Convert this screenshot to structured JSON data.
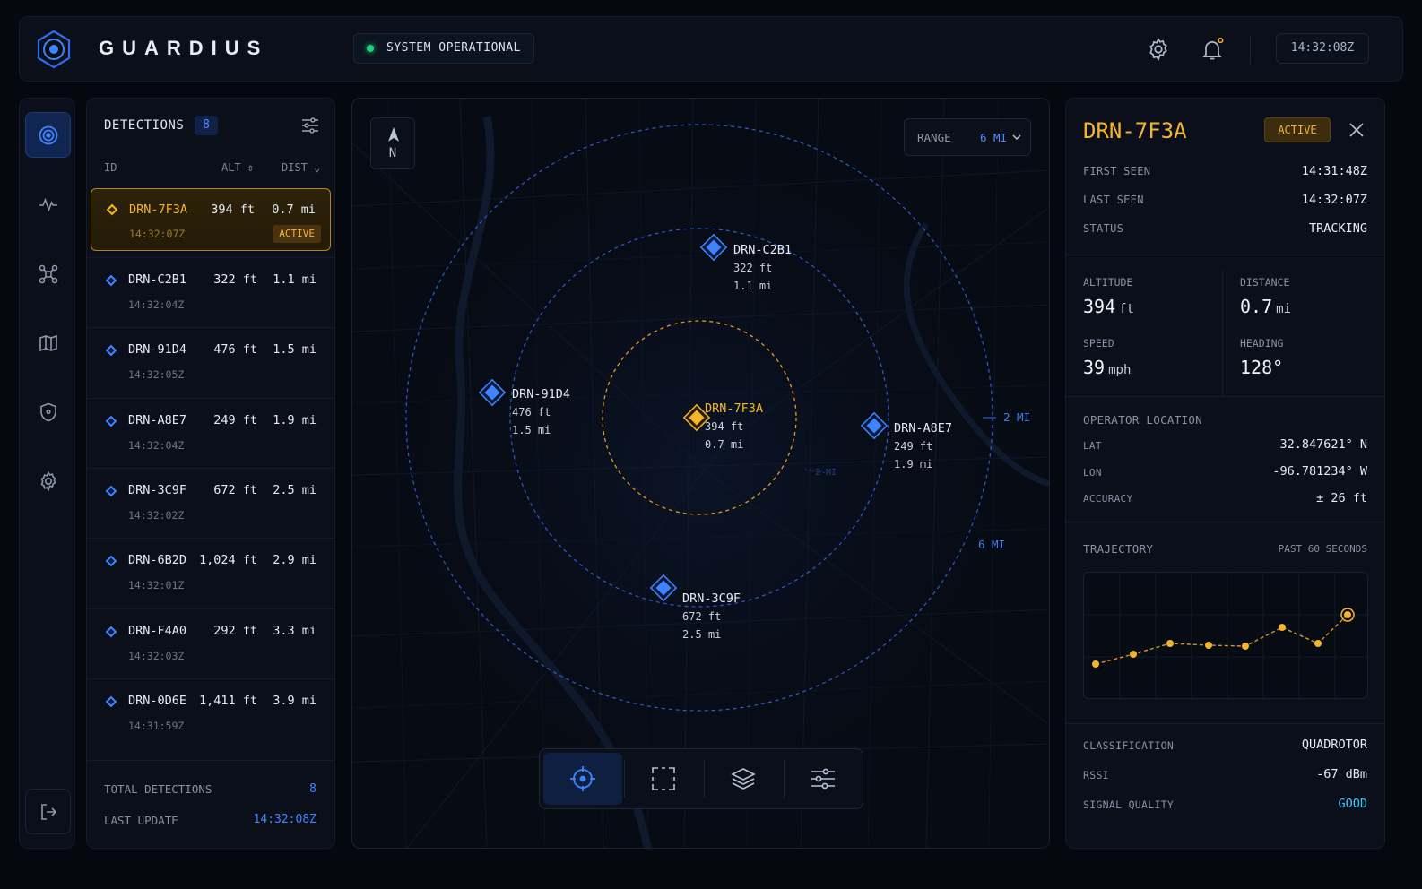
{
  "header": {
    "brand": "GUARDIUS",
    "status": "SYSTEM OPERATIONAL",
    "clock": "14:32:08Z",
    "icons": [
      "settings-gear-icon",
      "notification-bell-icon"
    ]
  },
  "rail": {
    "items": [
      "radar-icon",
      "activity-pulse-icon",
      "drone-icon",
      "map-icon",
      "shield-icon",
      "settings-icon"
    ],
    "active": "radar-icon",
    "logout": "logout-icon"
  },
  "detections": {
    "title": "DETECTIONS",
    "count": "8",
    "columns": {
      "id": "ID",
      "alt": "ALT",
      "dist": "DIST"
    },
    "rows": [
      {
        "id": "DRN-7F3A",
        "alt": "394 ft",
        "dist": "0.7 mi",
        "time": "14:32:07Z",
        "badge": "ACTIVE"
      },
      {
        "id": "DRN-C2B1",
        "alt": "322 ft",
        "dist": "1.1 mi",
        "time": "14:32:04Z"
      },
      {
        "id": "DRN-91D4",
        "alt": "476 ft",
        "dist": "1.5 mi",
        "time": "14:32:05Z"
      },
      {
        "id": "DRN-A8E7",
        "alt": "249 ft",
        "dist": "1.9 mi",
        "time": "14:32:04Z"
      },
      {
        "id": "DRN-3C9F",
        "alt": "672 ft",
        "dist": "2.5 mi",
        "time": "14:32:02Z"
      },
      {
        "id": "DRN-6B2D",
        "alt": "1,024 ft",
        "dist": "2.9 mi",
        "time": "14:32:01Z"
      },
      {
        "id": "DRN-F4A0",
        "alt": "292 ft",
        "dist": "3.3 mi",
        "time": "14:32:03Z"
      },
      {
        "id": "DRN-0D6E",
        "alt": "1,411 ft",
        "dist": "3.9 mi",
        "time": "14:31:59Z"
      }
    ],
    "footer": {
      "total_label": "TOTAL DETECTIONS",
      "total_value": "8",
      "update_label": "LAST UPDATE",
      "update_value": "14:32:08Z"
    }
  },
  "map": {
    "compass": "N",
    "range_label": "RANGE",
    "range_value": "6 MI",
    "rings": [
      "2 MI",
      "2 MI",
      "6 MI"
    ],
    "blips": [
      {
        "id": "DRN-7F3A",
        "alt": "394 ft",
        "dist": "0.7 mi",
        "selected": true
      },
      {
        "id": "DRN-C2B1",
        "alt": "322 ft",
        "dist": "1.1 mi"
      },
      {
        "id": "DRN-91D4",
        "alt": "476 ft",
        "dist": "1.5 mi"
      },
      {
        "id": "DRN-A8E7",
        "alt": "249 ft",
        "dist": "1.9 mi"
      },
      {
        "id": "DRN-3C9F",
        "alt": "672 ft",
        "dist": "2.5 mi"
      }
    ],
    "tools": [
      "target-crosshair-icon",
      "select-area-icon",
      "layers-icon",
      "sliders-icon"
    ],
    "active_tool": "target-crosshair-icon"
  },
  "detail": {
    "title": "DRN-7F3A",
    "badge": "ACTIVE",
    "first_seen_label": "FIRST SEEN",
    "first_seen": "14:31:48Z",
    "last_seen_label": "LAST SEEN",
    "last_seen": "14:32:07Z",
    "status_label": "STATUS",
    "status": "TRACKING",
    "altitude_label": "ALTITUDE",
    "altitude": "394",
    "altitude_unit": "ft",
    "distance_label": "DISTANCE",
    "distance": "0.7",
    "distance_unit": "mi",
    "speed_label": "SPEED",
    "speed": "39",
    "speed_unit": "mph",
    "heading_label": "HEADING",
    "heading": "128°",
    "operator_label": "OPERATOR LOCATION",
    "lat_label": "LAT",
    "lat": "32.847621° N",
    "lon_label": "LON",
    "lon": "-96.781234° W",
    "accuracy_label": "ACCURACY",
    "accuracy": "± 26 ft",
    "trajectory_label": "TRAJECTORY",
    "trajectory_window": "PAST 60 SECONDS",
    "classification_label": "CLASSIFICATION",
    "classification": "QUADROTOR",
    "rssi_label": "RSSI",
    "rssi": "-67 dBm",
    "signal_label": "SIGNAL QUALITY",
    "signal": "GOOD"
  },
  "colors": {
    "accent_blue": "#3f84ff",
    "accent_gold": "#f5b52a",
    "status_green": "#22d07a",
    "signal_good": "#38c6ff",
    "background": "#05080f"
  }
}
